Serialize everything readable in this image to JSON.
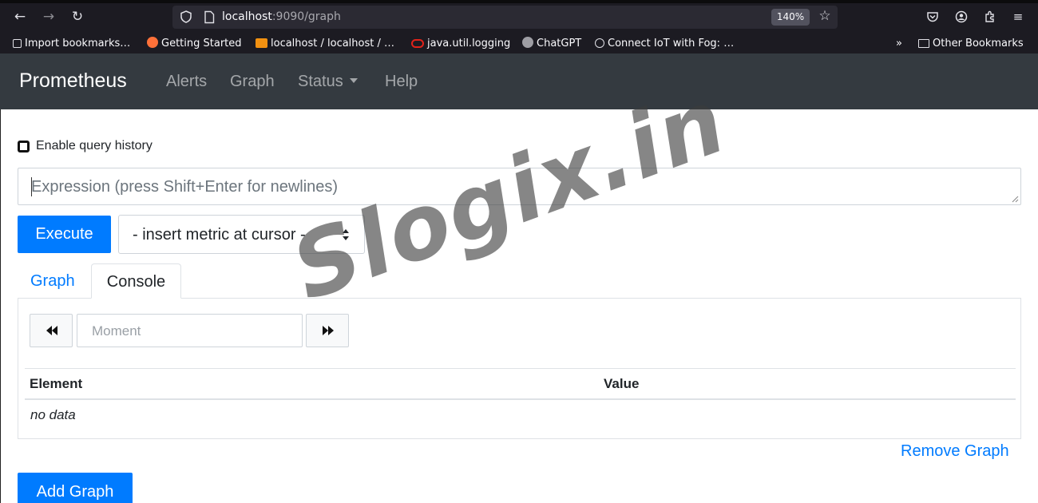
{
  "browser": {
    "url_host": "localhost",
    "url_rest": ":9090/graph",
    "zoom": "140%",
    "bookmarks": [
      {
        "label": "Import bookmarks…",
        "icon": "import-icon",
        "color": "#e0e0e6"
      },
      {
        "label": "Getting Started",
        "icon": "firefox-icon",
        "color": "#ff7139"
      },
      {
        "label": "localhost / localhost / …",
        "icon": "phpmyadmin-icon",
        "color": "#f29111"
      },
      {
        "label": "java.util.logging",
        "icon": "oracle-icon",
        "color": "#e2231a"
      },
      {
        "label": "ChatGPT",
        "icon": "chatgpt-icon",
        "color": "#9e9ea4"
      },
      {
        "label": "Connect IoT with Fog: …",
        "icon": "globe-icon",
        "color": "#e0e0e6"
      }
    ],
    "overflow": "»",
    "other_bookmarks": "Other Bookmarks"
  },
  "navbar": {
    "brand": "Prometheus",
    "links": [
      "Alerts",
      "Graph",
      "Status",
      "Help"
    ]
  },
  "page": {
    "history_label": "Enable query history",
    "expression_placeholder": "Expression (press Shift+Enter for newlines)",
    "execute_label": "Execute",
    "metric_select_value": "- insert metric at cursor -",
    "tabs": [
      "Graph",
      "Console"
    ],
    "active_tab": "Console",
    "moment_placeholder": "Moment",
    "table_headers": [
      "Element",
      "Value"
    ],
    "no_data": "no data",
    "remove_graph": "Remove Graph",
    "add_graph": "Add Graph"
  },
  "watermark": "Slogix.in",
  "colors": {
    "accent": "#007bff",
    "navbar_bg": "#343a40",
    "browser_bg": "#1c1b22"
  }
}
